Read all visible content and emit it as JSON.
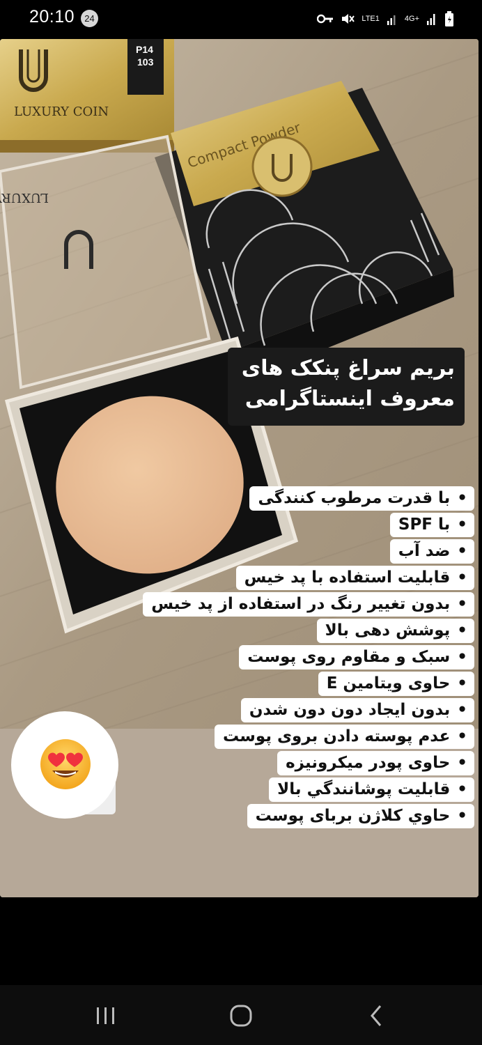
{
  "status_bar": {
    "time": "20:10",
    "notification_count": "24",
    "network_label": "LTE1",
    "network_type": "4G+"
  },
  "story": {
    "product_box": {
      "brand": "LUXURY COIN",
      "product_name": "Compact Powder",
      "shade_code": "P14",
      "shade_number": "103"
    },
    "headline": {
      "line1": "بریم سراغ پنکک های",
      "line2": "معروف اینستاگرامی"
    },
    "features": [
      "با قدرت مرطوب کنندگی",
      "با SPF",
      "ضد آب",
      "قابلیت استفاده با پد خیس",
      "بدون تغییر رنگ در استفاده از پد خیس",
      "پوشش دهی بالا",
      "سبک و مقاوم روی پوست",
      "حاوی ویتامین E",
      "بدون ایجاد دون دون شدن",
      "عدم پوسته دادن بروی پوست",
      "حاوی پودر میکرونیزه",
      "قابلیت پوشانندگي بالا",
      "حاوي کلاژن بربای پوست"
    ],
    "bullet": "•",
    "sticker": "heart-eyes-emoji"
  },
  "colors": {
    "wood": "#b0a18c",
    "gold": "#d4ba6a",
    "powder": "#e7bc95",
    "headline_bg": "#1b1b1b"
  },
  "nav_bar": {
    "recents": "recent-apps-icon",
    "home": "home-icon",
    "back": "back-icon"
  }
}
